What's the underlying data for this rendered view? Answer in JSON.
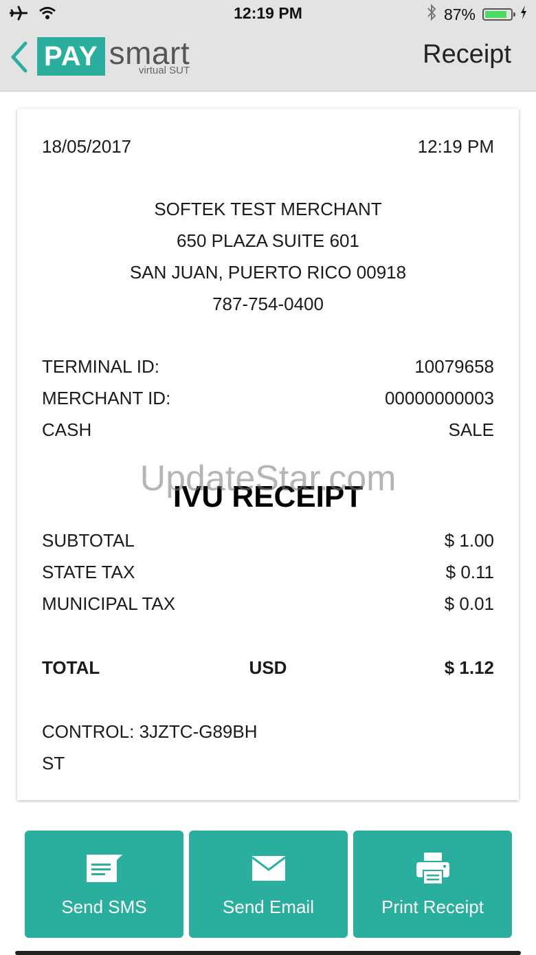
{
  "status_bar": {
    "time": "12:19 PM",
    "battery_percent": "87%",
    "battery_level": 0.87
  },
  "nav": {
    "logo_pay": "PAY",
    "logo_smart": "smart",
    "logo_sub": "virtual SUT",
    "title": "Receipt"
  },
  "receipt": {
    "date": "18/05/2017",
    "time": "12:19 PM",
    "merchant_lines": [
      "SOFTEK TEST MERCHANT",
      "650 PLAZA SUITE 601",
      "SAN JUAN, PUERTO RICO 00918",
      "787-754-0400"
    ],
    "terminal_label": "TERMINAL ID:",
    "terminal_value": "10079658",
    "merchant_label": "MERCHANT ID:",
    "merchant_value": "00000000003",
    "payment_type": "CASH",
    "transaction_type": "SALE",
    "heading": "IVU RECEIPT",
    "watermark": "UpdateStar.com",
    "lines": [
      {
        "label": "SUBTOTAL",
        "value": "$ 1.00"
      },
      {
        "label": "STATE TAX",
        "value": "$ 0.11"
      },
      {
        "label": "MUNICIPAL TAX",
        "value": "$ 0.01"
      }
    ],
    "total_label": "TOTAL",
    "total_currency": "USD",
    "total_value": "$ 1.12",
    "control": "CONTROL: 3JZTC-G89BH",
    "st": "ST"
  },
  "actions": {
    "sms_label": "Send SMS",
    "email_label": "Send Email",
    "print_label": "Print Receipt"
  },
  "colors": {
    "accent": "#2aaf9e",
    "bar_bg": "#e3e3e3",
    "battery_green": "#4cd964"
  }
}
